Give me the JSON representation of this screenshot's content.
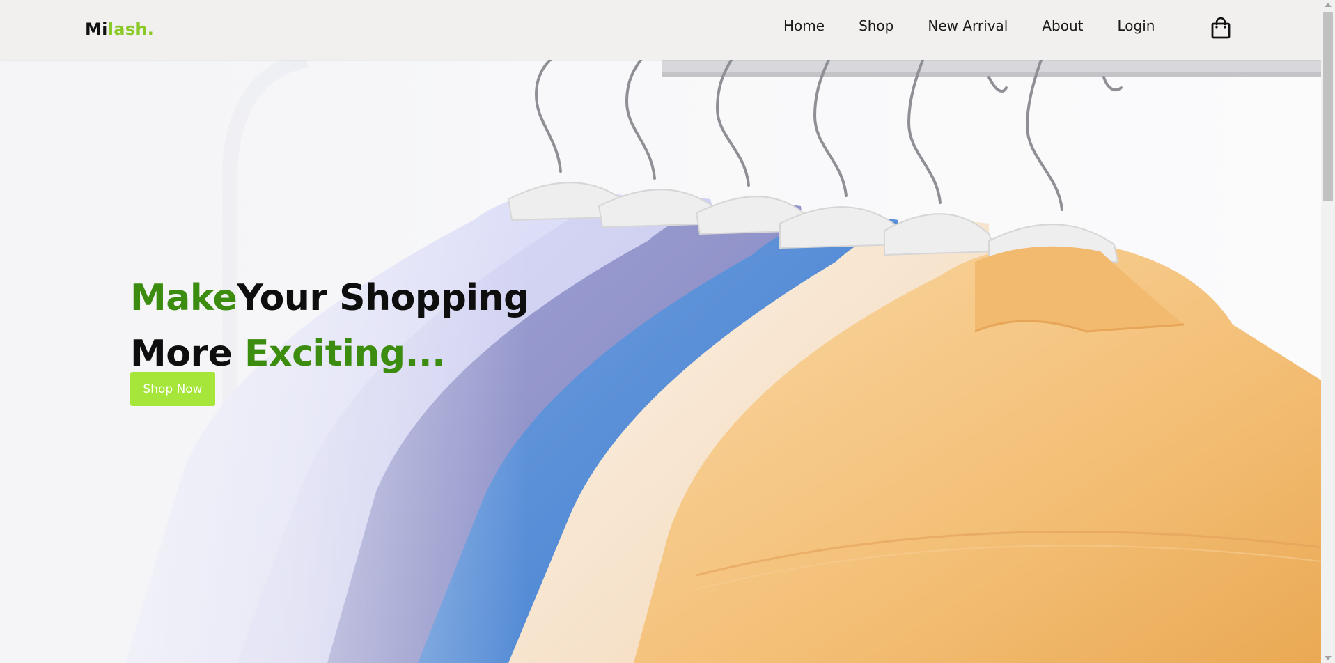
{
  "brand": {
    "logo_part1": "Mi",
    "logo_part2": "lash."
  },
  "nav": {
    "links": [
      "Home",
      "Shop",
      "New Arrival",
      "About",
      "Login"
    ],
    "cart_icon": "shopping-bag-icon"
  },
  "hero": {
    "line1_green": "Make",
    "line1_rest": "Your Shopping",
    "line2_start": "More ",
    "line2_green": "Exciting...",
    "cta_label": "Shop Now"
  },
  "colors": {
    "header_bg": "#f1f0ee",
    "brand_green": "#8ac926",
    "headline_green": "#3c8d0f",
    "cta_bg": "#a6e63b"
  }
}
